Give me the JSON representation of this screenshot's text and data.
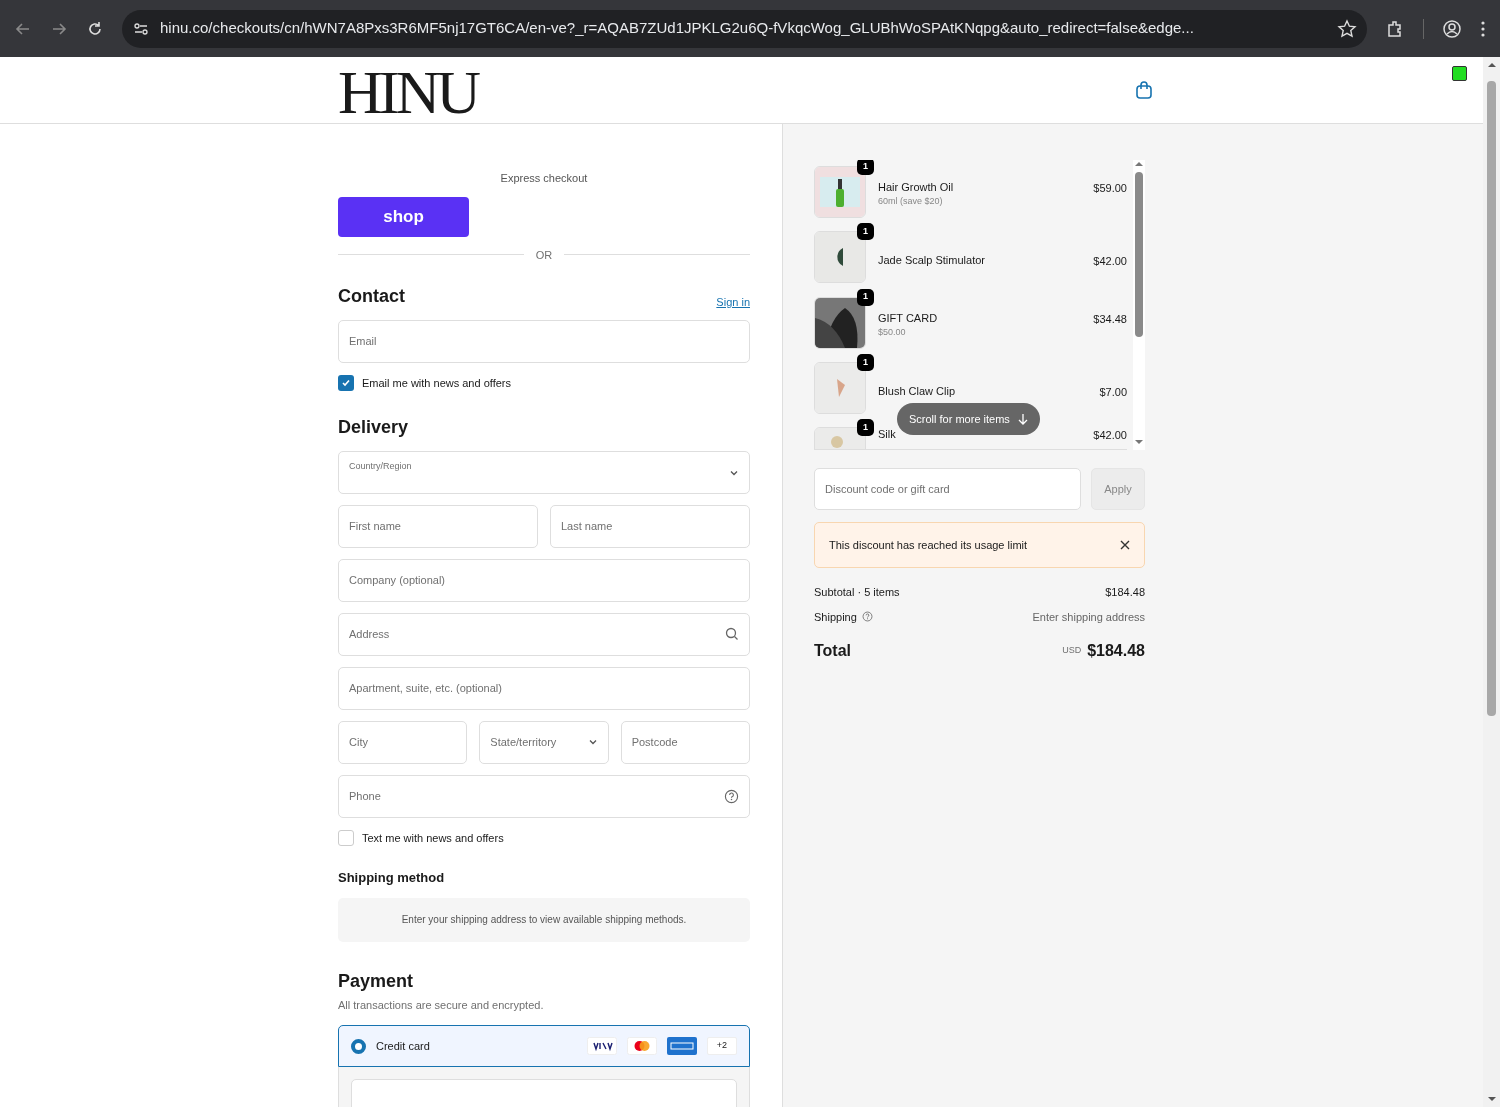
{
  "browser": {
    "url": "hinu.co/checkouts/cn/hWN7A8Pxs3R6MF5nj17GT6CA/en-ve?_r=AQAB7ZUd1JPKLG2u6Q-fVkqcWog_GLUBhWoSPAtKNqpg&auto_redirect=false&edge..."
  },
  "header": {
    "logo": "HINU"
  },
  "express": {
    "title": "Express checkout",
    "shop_button": "shop",
    "divider": "OR"
  },
  "contact": {
    "title": "Contact",
    "sign_in": "Sign in",
    "email": {
      "placeholder": "Email"
    },
    "newsletter": {
      "label": "Email me with news and offers",
      "checked": true
    }
  },
  "delivery": {
    "title": "Delivery",
    "fields": [
      {
        "kind": "select",
        "label": "Country/Region"
      },
      {
        "kind": "text",
        "placeholder": "First name"
      },
      {
        "kind": "text",
        "placeholder": "Last name"
      },
      {
        "kind": "text",
        "placeholder": "Company (optional)"
      },
      {
        "kind": "search",
        "placeholder": "Address"
      },
      {
        "kind": "text",
        "placeholder": "Apartment, suite, etc. (optional)"
      },
      {
        "kind": "text",
        "placeholder": "City"
      },
      {
        "kind": "dropdown",
        "placeholder": "State/territory"
      },
      {
        "kind": "text",
        "placeholder": "Postcode"
      },
      {
        "kind": "help",
        "placeholder": "Phone"
      }
    ],
    "sms": {
      "label": "Text me with news and offers",
      "checked": false
    }
  },
  "shipping_method": {
    "title": "Shipping method",
    "notice": "Enter your shipping address to view available shipping methods."
  },
  "payment": {
    "title": "Payment",
    "subtitle": "All transactions are secure and encrypted.",
    "methods": [
      {
        "label": "Credit card",
        "selected": true,
        "more": "+2"
      }
    ]
  },
  "cart": {
    "items": [
      {
        "name": "Hair Growth Oil",
        "variant": "60ml (save $20)",
        "price": "$59.00",
        "quantity": "1"
      },
      {
        "name": "Jade Scalp Stimulator",
        "price": "$42.00",
        "quantity": "1"
      },
      {
        "name": "GIFT CARD",
        "variant": "$50.00",
        "price": "$34.48",
        "quantity": "1"
      },
      {
        "name": "Blush Claw Clip",
        "price": "$7.00",
        "quantity": "1"
      },
      {
        "name": "Silk",
        "price": "$42.00",
        "quantity": "1"
      }
    ],
    "scroll_hint": "Scroll for more items"
  },
  "discount": {
    "placeholder": "Discount code or gift card",
    "button": "Apply",
    "error": "This discount has reached its usage limit"
  },
  "summary": {
    "subtotal_label": "Subtotal · 5 items",
    "subtotal": "$184.48",
    "shipping_label": "Shipping",
    "shipping": "Enter shipping address",
    "total_label": "Total",
    "currency": "USD",
    "total": "$184.48"
  }
}
